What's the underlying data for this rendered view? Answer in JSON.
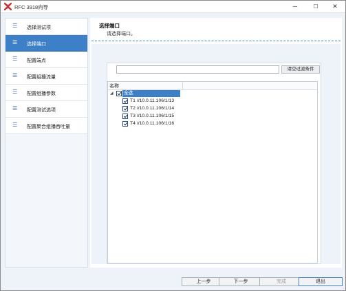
{
  "window": {
    "title": "RFC 3918向导",
    "minimize": "─",
    "maximize": "☐",
    "close": "✕"
  },
  "sidebar": {
    "items": [
      {
        "label": "选择测试项",
        "active": false
      },
      {
        "label": "选择端口",
        "active": true
      },
      {
        "label": "配置端点",
        "active": false
      },
      {
        "label": "配置组播流量",
        "active": false
      },
      {
        "label": "配置组播参数",
        "active": false
      },
      {
        "label": "配置测试选项",
        "active": false
      },
      {
        "label": "配置聚合组播吞吐量",
        "active": false
      }
    ]
  },
  "main": {
    "title": "选择端口",
    "subtitle": "请选择端口。",
    "filter": {
      "value": "",
      "button_label": "请空过滤条件"
    },
    "tree": {
      "column_header": "名称",
      "root": {
        "label": "全选",
        "checked": true,
        "expander": "◢"
      },
      "ports": [
        {
          "label": "T1 //10.0.11.106/1/13",
          "checked": true
        },
        {
          "label": "T2 //10.0.11.106/1/14",
          "checked": true
        },
        {
          "label": "T3 //10.0.11.106/1/15",
          "checked": true
        },
        {
          "label": "T4 //10.0.11.106/1/16",
          "checked": true
        }
      ]
    }
  },
  "footer": {
    "prev": "上一步",
    "next": "下一步",
    "finish": "完成",
    "exit": "退出"
  }
}
